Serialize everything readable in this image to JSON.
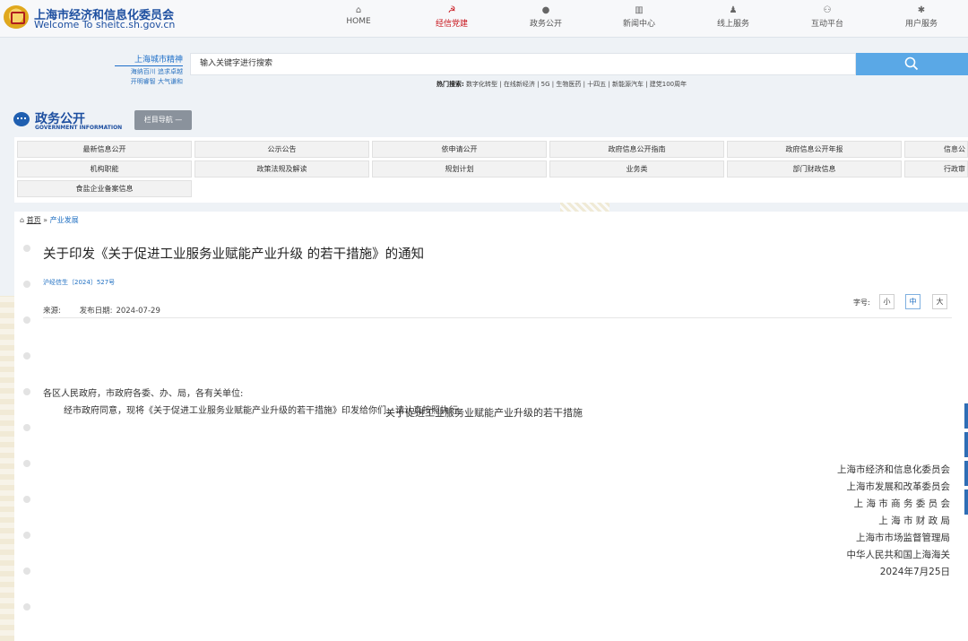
{
  "header": {
    "title": "上海市经济和信息化委员会",
    "subtitle": "Welcome To sheitc.sh.gov.cn",
    "nav": [
      {
        "label": "HOME",
        "icon": "home-icon",
        "glyph": "⌂"
      },
      {
        "label": "经信党建",
        "icon": "party-emblem-icon",
        "glyph": "☭",
        "active": true
      },
      {
        "label": "政务公开",
        "icon": "chat-bubble-icon",
        "glyph": "●"
      },
      {
        "label": "新闻中心",
        "icon": "newspaper-icon",
        "glyph": "▥"
      },
      {
        "label": "线上服务",
        "icon": "user-service-icon",
        "glyph": "♟"
      },
      {
        "label": "互动平台",
        "icon": "interaction-icon",
        "glyph": "⚇"
      },
      {
        "label": "用户服务",
        "icon": "gear-icon",
        "glyph": "✱"
      }
    ]
  },
  "search": {
    "slogan_title": "上海城市精神",
    "slogan_line1": "海纳百川 追求卓越",
    "slogan_line2": "开明睿智 大气谦和",
    "placeholder": "输入关键字进行搜索",
    "hot_label": "热门搜索:",
    "hot_terms": "数字化转型 | 在线新经济 | 5G | 生物医药 | 十四五 | 新能源汽车 | 建党100周年"
  },
  "gov": {
    "title": "政务公开",
    "subtitle": "GOVERNMENT INFORMATION",
    "column_nav": "栏目导航 —"
  },
  "columns": [
    [
      "最新信息公开",
      "公示公告",
      "依申请公开",
      "政府信息公开指南",
      "政府信息公开年报",
      "信息公"
    ],
    [
      "机构职能",
      "政策法规及解读",
      "规划计划",
      "业务类",
      "部门财政信息",
      "行政审"
    ],
    [
      "食盐企业备案信息"
    ]
  ],
  "breadcrumb": {
    "home": "首页",
    "sep": "»",
    "current": "产业发展"
  },
  "article": {
    "title": "关于印发《关于促进工业服务业赋能产业升级 的若干措施》的通知",
    "doc_no": "沪经信生〔2024〕527号",
    "source_label": "来源:",
    "date_label": "发布日期:",
    "date": "2024-07-29",
    "font_size_label": "字号:",
    "font_small": "小",
    "font_medium": "中",
    "font_large": "大",
    "salutation": "各区人民政府，市政府各委、办、局，各有关单位:",
    "body": "经市政府同意，现将《关于促进工业服务业赋能产业升级的若干措施》印发给你们，请认真按照执行。",
    "signatories": [
      "上海市经济和信息化委员会",
      "上海市发展和改革委员会",
      "上 海 市 商 务 委 员 会",
      "上 海 市 财 政 局",
      "上海市市场监督管理局",
      "中华人民共和国上海海关",
      "2024年7月25日"
    ],
    "attachment_title": "关于促进工业服务业赋能产业升级的若干措施"
  }
}
